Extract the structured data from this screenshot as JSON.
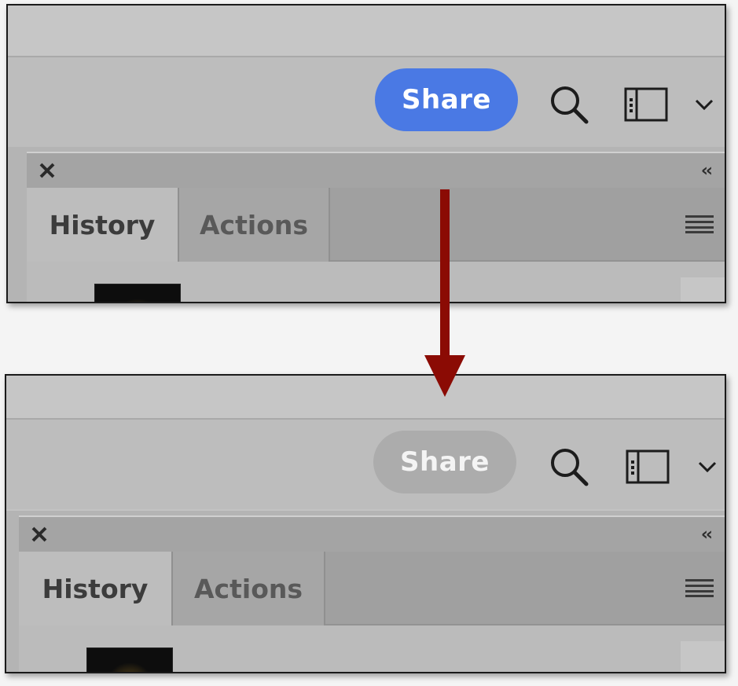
{
  "panels": [
    {
      "state": "before",
      "share_label": "Share",
      "share_color": "#4a79e4",
      "tabs": [
        {
          "label": "History",
          "selected": true
        },
        {
          "label": "Actions",
          "selected": false
        }
      ],
      "icons": [
        "search-icon",
        "workspace-icon",
        "chevron-down-icon",
        "close-icon",
        "collapse-icon",
        "panel-menu-icon"
      ]
    },
    {
      "state": "after",
      "share_label": "Share",
      "share_color": "#acacac",
      "tabs": [
        {
          "label": "History",
          "selected": true
        },
        {
          "label": "Actions",
          "selected": false
        }
      ],
      "icons": [
        "search-icon",
        "workspace-icon",
        "chevron-down-icon",
        "close-icon",
        "collapse-icon",
        "panel-menu-icon"
      ]
    }
  ],
  "collapse_glyph": "‹‹",
  "arrow_color": "#8b0b04"
}
